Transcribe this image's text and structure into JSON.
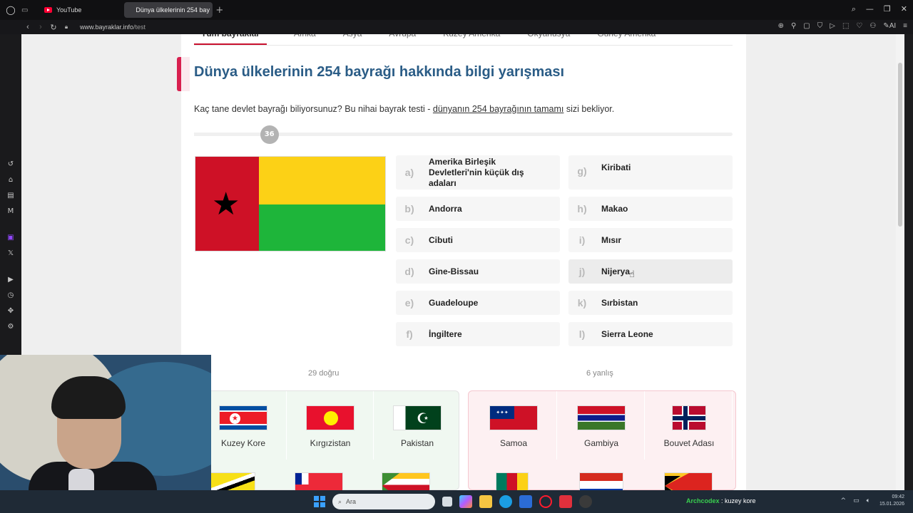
{
  "browser": {
    "tabs": [
      {
        "label": "YouTube",
        "active": false
      },
      {
        "label": "Dünya ülkelerinin 254 bay",
        "active": true
      }
    ],
    "url_host": "www.bayraklar.info",
    "url_path": "/test"
  },
  "subnav": [
    "Tüm bayraklar",
    "Afrika",
    "Asya",
    "Avrupa",
    "Kuzey Amerika",
    "Okyanusya",
    "Güney Amerika"
  ],
  "quiz": {
    "title": "Dünya ülkelerinin 254 bayrağı hakkında bilgi yarışması",
    "lead_before": "Kaç tane devlet bayrağı biliyorsunuz? Bu nihai bayrak testi - ",
    "lead_link": "dünyanın 254 bayrağının tamamı",
    "lead_after": " sizi bekliyor.",
    "progress_number": "36",
    "progress_fraction": 0.14,
    "options_left": [
      {
        "letter": "a)",
        "label": "Amerika Birleşik Devletleri'nin küçük dış adaları"
      },
      {
        "letter": "b)",
        "label": "Andorra"
      },
      {
        "letter": "c)",
        "label": "Cibuti"
      },
      {
        "letter": "d)",
        "label": "Gine-Bissau"
      },
      {
        "letter": "e)",
        "label": "Guadeloupe"
      },
      {
        "letter": "f)",
        "label": "İngiltere"
      }
    ],
    "options_right": [
      {
        "letter": "g)",
        "label": "Kiribati"
      },
      {
        "letter": "h)",
        "label": "Makao"
      },
      {
        "letter": "i)",
        "label": "Mısır"
      },
      {
        "letter": "j)",
        "label": "Nijerya"
      },
      {
        "letter": "k)",
        "label": "Sırbistan"
      },
      {
        "letter": "l)",
        "label": "Sierra Leone"
      }
    ],
    "correct_count": "29 doğru",
    "wrong_count": "6 yanlış",
    "correct_flags": [
      "Kuzey Kore",
      "Kırgızistan",
      "Pakistan"
    ],
    "wrong_flags": [
      "Samoa",
      "Gambiya",
      "Bouvet Adası"
    ]
  },
  "colors": {
    "title": "#2a5c86",
    "accent": "#d8204f",
    "flag_red": "#ce1126",
    "flag_yellow": "#fcd116",
    "flag_green": "#1eb53a"
  },
  "taskbar": {
    "search_placeholder": "Ara",
    "chat_user": "Archcodex",
    "chat_message": " : kuzey kore",
    "time": "09:42",
    "date": "15.01.2026"
  }
}
